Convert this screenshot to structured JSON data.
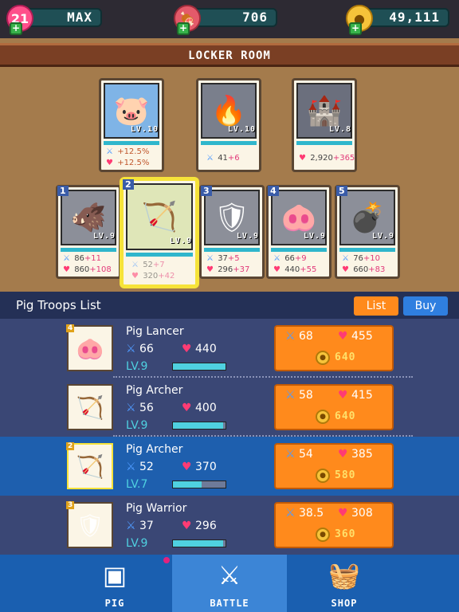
{
  "top_bar": {
    "hearts": {
      "value": "21",
      "label": "MAX"
    },
    "meat": {
      "value": "706"
    },
    "coins": {
      "value": "49,111"
    }
  },
  "locker_room": {
    "title": "LOCKER ROOM",
    "equipment": [
      {
        "level": "LV.10",
        "stat1": "+12.5%",
        "stat2": "+12.5%",
        "art": "pig-hero"
      },
      {
        "level": "LV.10",
        "atk_base": "41",
        "atk_bonus": "+6",
        "art": "fire-brazier"
      },
      {
        "level": "LV.8",
        "hp_base": "2,920",
        "hp_bonus": "+365",
        "art": "castle"
      }
    ],
    "team": [
      {
        "slot": "1",
        "level": "LV.9",
        "atk_base": "86",
        "atk_bonus": "+11",
        "hp_base": "860",
        "hp_bonus": "+108"
      },
      {
        "slot": "2",
        "level": "LV.9",
        "atk_base": "52",
        "atk_bonus": "+7",
        "hp_base": "320",
        "hp_bonus": "+42"
      },
      {
        "slot": "3",
        "level": "LV.9",
        "atk_base": "37",
        "atk_bonus": "+5",
        "hp_base": "296",
        "hp_bonus": "+37"
      },
      {
        "slot": "4",
        "level": "LV.9",
        "atk_base": "66",
        "atk_bonus": "+9",
        "hp_base": "440",
        "hp_bonus": "+55"
      },
      {
        "slot": "5",
        "level": "LV.9",
        "atk_base": "76",
        "atk_bonus": "+10",
        "hp_base": "660",
        "hp_bonus": "+83"
      }
    ]
  },
  "troops": {
    "title": "Pig Troops List",
    "list_button": "List",
    "buy_button": "Buy",
    "rows": [
      {
        "slot": "4",
        "name": "Pig Lancer",
        "atk": "66",
        "hp": "440",
        "level": "LV.9",
        "level_fill": 1.0,
        "up_atk": "68",
        "up_hp": "455",
        "cost": "640"
      },
      {
        "slot": "",
        "name": "Pig Archer",
        "atk": "56",
        "hp": "400",
        "level": "LV.9",
        "level_fill": 0.95,
        "up_atk": "58",
        "up_hp": "415",
        "cost": "640"
      },
      {
        "slot": "2",
        "name": "Pig Archer",
        "atk": "52",
        "hp": "370",
        "level": "LV.7",
        "level_fill": 0.55,
        "up_atk": "54",
        "up_hp": "385",
        "cost": "580"
      },
      {
        "slot": "3",
        "name": "Pig Warrior",
        "atk": "37",
        "hp": "296",
        "level": "LV.9",
        "level_fill": 0.95,
        "up_atk": "38.5",
        "up_hp": "308",
        "cost": "360"
      }
    ]
  },
  "nav": {
    "tabs": [
      {
        "label": "PIG"
      },
      {
        "label": "BATTLE"
      },
      {
        "label": "SHOP"
      }
    ]
  },
  "colors": {
    "accent": "#ff8a1c",
    "selected_row": "#1e5fae",
    "nav_active": "#3c85d6"
  }
}
